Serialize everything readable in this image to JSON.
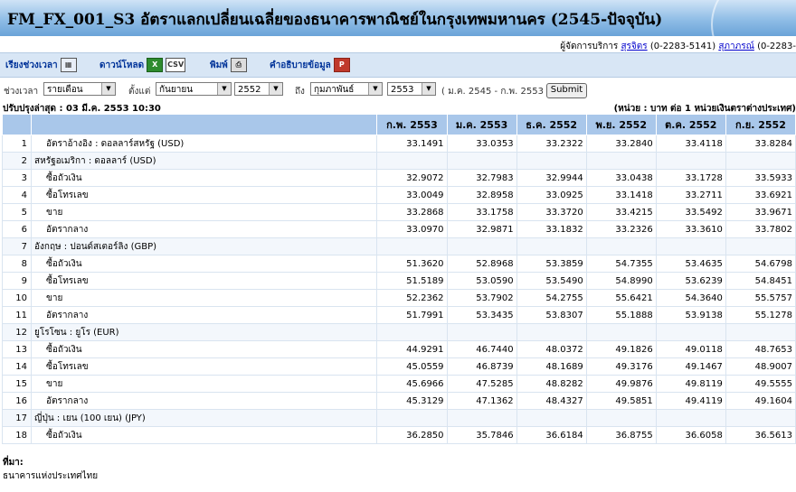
{
  "banner": {
    "title": "FM_FX_001_S3 อัตราแลกเปลี่ยนเฉลี่ยของธนาคารพาณิชย์ในกรุงเทพมหานคร (2545-ปัจจุบัน)"
  },
  "contact": {
    "prefix": "ผู้จัดการบริการ",
    "name1": "สุรจิตร",
    "phone1": "(0-2283-5141)",
    "name2": "สุภาภรณ์",
    "phone2": "(0-2283-"
  },
  "toolbar": {
    "period": "เรียงช่วงเวลา",
    "download": "ดาวน์โหลด",
    "csv": "CSV",
    "print": "พิมพ์",
    "explain": "คำอธิบายข้อมูล"
  },
  "filter": {
    "period_label": "ช่วงเวลา",
    "period_value": "รายเดือน",
    "from_label": "ตั้งแต่",
    "from_month": "กันยายน",
    "from_year": "2552",
    "to_label": "ถึง",
    "to_month": "กุมภาพันธ์",
    "to_year": "2553",
    "range": "( ม.ค. 2545 - ก.พ. 2553 )",
    "submit": "Submit"
  },
  "updated": "ปรับปรุงล่าสุด : 03 มี.ค. 2553 10:30",
  "unit": "(หน่วย : บาท ต่อ 1 หน่วยเงินตราต่างประเทศ)",
  "table": {
    "columns": [
      "ก.พ. 2553",
      "ม.ค. 2553",
      "ธ.ค. 2552",
      "พ.ย. 2552",
      "ต.ค. 2552",
      "ก.ย. 2552"
    ],
    "rows": [
      {
        "n": "1",
        "label": "อัตราอ้างอิง : ดอลลาร์สหรัฐ (USD)",
        "values": [
          "33.1491",
          "33.0353",
          "33.2322",
          "33.2840",
          "33.4118",
          "33.8284"
        ]
      },
      {
        "n": "2",
        "label": "สหรัฐอเมริกา : ดอลลาร์ (USD)",
        "values": [
          "",
          "",
          "",
          "",
          "",
          ""
        ]
      },
      {
        "n": "3",
        "label": "ซื้อถัวเงิน",
        "values": [
          "32.9072",
          "32.7983",
          "32.9944",
          "33.0438",
          "33.1728",
          "33.5933"
        ]
      },
      {
        "n": "4",
        "label": "ซื้อโทรเลข",
        "values": [
          "33.0049",
          "32.8958",
          "33.0925",
          "33.1418",
          "33.2711",
          "33.6921"
        ]
      },
      {
        "n": "5",
        "label": "ขาย",
        "values": [
          "33.2868",
          "33.1758",
          "33.3720",
          "33.4215",
          "33.5492",
          "33.9671"
        ]
      },
      {
        "n": "6",
        "label": "อัตรากลาง",
        "values": [
          "33.0970",
          "32.9871",
          "33.1832",
          "33.2326",
          "33.3610",
          "33.7802"
        ]
      },
      {
        "n": "7",
        "label": "อังกฤษ : ปอนด์สเตอร์ลิง (GBP)",
        "values": [
          "",
          "",
          "",
          "",
          "",
          ""
        ]
      },
      {
        "n": "8",
        "label": "ซื้อถัวเงิน",
        "values": [
          "51.3620",
          "52.8968",
          "53.3859",
          "54.7355",
          "53.4635",
          "54.6798"
        ]
      },
      {
        "n": "9",
        "label": "ซื้อโทรเลข",
        "values": [
          "51.5189",
          "53.0590",
          "53.5490",
          "54.8990",
          "53.6239",
          "54.8451"
        ]
      },
      {
        "n": "10",
        "label": "ขาย",
        "values": [
          "52.2362",
          "53.7902",
          "54.2755",
          "55.6421",
          "54.3640",
          "55.5757"
        ]
      },
      {
        "n": "11",
        "label": "อัตรากลาง",
        "values": [
          "51.7991",
          "53.3435",
          "53.8307",
          "55.1888",
          "53.9138",
          "55.1278"
        ]
      },
      {
        "n": "12",
        "label": "ยูโรโซน : ยูโร (EUR)",
        "values": [
          "",
          "",
          "",
          "",
          "",
          ""
        ]
      },
      {
        "n": "13",
        "label": "ซื้อถัวเงิน",
        "values": [
          "44.9291",
          "46.7440",
          "48.0372",
          "49.1826",
          "49.0118",
          "48.7653"
        ]
      },
      {
        "n": "14",
        "label": "ซื้อโทรเลข",
        "values": [
          "45.0559",
          "46.8739",
          "48.1689",
          "49.3176",
          "49.1467",
          "48.9007"
        ]
      },
      {
        "n": "15",
        "label": "ขาย",
        "values": [
          "45.6966",
          "47.5285",
          "48.8282",
          "49.9876",
          "49.8119",
          "49.5555"
        ]
      },
      {
        "n": "16",
        "label": "อัตรากลาง",
        "values": [
          "45.3129",
          "47.1362",
          "48.4327",
          "49.5851",
          "49.4119",
          "49.1604"
        ]
      },
      {
        "n": "17",
        "label": "ญี่ปุ่น : เยน (100 เยน) (JPY)",
        "values": [
          "",
          "",
          "",
          "",
          "",
          ""
        ]
      },
      {
        "n": "18",
        "label": "ซื้อถัวเงิน",
        "values": [
          "36.2850",
          "35.7846",
          "36.6184",
          "36.8755",
          "36.6058",
          "36.5613"
        ]
      }
    ]
  },
  "source": {
    "heading": "ที่มา:",
    "text": "ธนาคารแห่งประเทศไทย"
  }
}
